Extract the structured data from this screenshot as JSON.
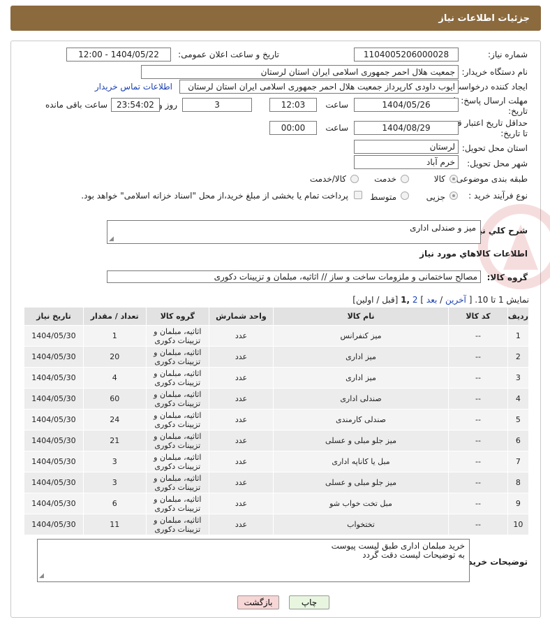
{
  "header": {
    "title": "جزئیات اطلاعات نیاز"
  },
  "form": {
    "need_number_label": "شماره نیاز:",
    "need_number": "1104005206000028",
    "announce_label": "تاریخ و ساعت اعلان عمومی:",
    "announce_value": "1404/05/22 - 12:00",
    "buyer_org_label": "نام دستگاه خریدار:",
    "buyer_org": "جمعیت هلال احمر جمهوری اسلامی ایران استان لرستان",
    "creator_label": "ایجاد کننده درخواست:",
    "creator": "ایوب داودی کارپرداز جمعیت هلال احمر جمهوری اسلامی ایران استان لرستان",
    "contact_link": "اطلاعات تماس خریدار",
    "deadline_label_1": "مهلت ارسال پاسخ: تا",
    "deadline_label_2": "تاریخ:",
    "deadline_date": "1404/05/26",
    "time_label": "ساعت",
    "deadline_time": "12:03",
    "days_value": "3",
    "days_label": "روز و",
    "remaining_time": "23:54:02",
    "remaining_label": "ساعت باقی مانده",
    "validity_label_1": "حداقل تاریخ اعتبار قیمت:",
    "validity_label_2": "تا تاریخ:",
    "validity_date": "1404/08/29",
    "validity_time": "00:00",
    "province_label": "استان محل تحویل:",
    "province": "لرستان",
    "city_label": "شهر محل تحویل:",
    "city": "خرم آباد",
    "category_label": "طبقه بندی موضوعی:",
    "category_options": [
      "کالا",
      "خدمت",
      "کالا/خدمت"
    ],
    "process_label": "نوع فرآیند خرید :",
    "process_options": [
      "جزیی",
      "متوسط"
    ],
    "payment_note": "پرداخت تمام یا بخشی از مبلغ خرید،از محل \"اسناد خزانه اسلامی\" خواهد بود.",
    "summary_label": "شرح کلي نياز:",
    "summary_value": "میز و صندلی اداری",
    "goods_info_title": "اطلاعات کالاهاي مورد نياز",
    "goods_group_label": "گروه کالا:",
    "goods_group_value": "مصالح ساختمانی و ملزومات ساخت و ساز // اثاثیه، مبلمان و تزیینات دکوری"
  },
  "pagination": {
    "showing": "نمایش 1 تا 10.",
    "open": "[",
    "last": "آخرین",
    "sep1": "/",
    "next": "بعد",
    "close": "]",
    "page2": "2",
    "page1": ",1",
    "prev_first": "[قبل / اولین]"
  },
  "table": {
    "headers": [
      "ردیف",
      "کد کالا",
      "نام کالا",
      "واحد شمارش",
      "گروه کالا",
      "تعداد / مقدار",
      "تاریخ نیاز"
    ],
    "rows": [
      [
        "1",
        "--",
        "میز کنفرانس",
        "عدد",
        "اثاثیه، مبلمان و تزیینات دکوری",
        "1",
        "1404/05/30"
      ],
      [
        "2",
        "--",
        "میز اداری",
        "عدد",
        "اثاثیه، مبلمان و تزیینات دکوری",
        "20",
        "1404/05/30"
      ],
      [
        "3",
        "--",
        "میز اداری",
        "عدد",
        "اثاثیه، مبلمان و تزیینات دکوری",
        "4",
        "1404/05/30"
      ],
      [
        "4",
        "--",
        "صندلی اداری",
        "عدد",
        "اثاثیه، مبلمان و تزیینات دکوری",
        "60",
        "1404/05/30"
      ],
      [
        "5",
        "--",
        "صندلی کارمندی",
        "عدد",
        "اثاثیه، مبلمان و تزیینات دکوری",
        "24",
        "1404/05/30"
      ],
      [
        "6",
        "--",
        "میز جلو مبلی و عسلی",
        "عدد",
        "اثاثیه، مبلمان و تزیینات دکوری",
        "21",
        "1404/05/30"
      ],
      [
        "7",
        "--",
        "مبل یا کاناپه اداری",
        "عدد",
        "اثاثیه، مبلمان و تزیینات دکوری",
        "3",
        "1404/05/30"
      ],
      [
        "8",
        "--",
        "میز جلو مبلی و عسلی",
        "عدد",
        "اثاثیه، مبلمان و تزیینات دکوری",
        "3",
        "1404/05/30"
      ],
      [
        "9",
        "--",
        "مبل تخت خواب شو",
        "عدد",
        "اثاثیه، مبلمان و تزیینات دکوری",
        "6",
        "1404/05/30"
      ],
      [
        "10",
        "--",
        "تختخواب",
        "عدد",
        "اثاثیه، مبلمان و تزیینات دکوری",
        "11",
        "1404/05/30"
      ]
    ]
  },
  "notes": {
    "label": "توضیحات خریدار:",
    "line1": "خرید مبلمان اداری طبق لیست پیوست",
    "line2": "به توضیحات لیست دقت گردد"
  },
  "buttons": {
    "print": "چاپ",
    "back": "بازگشت"
  },
  "colors": {
    "header_bg": "#8b6a3e",
    "link": "#1a3fb0",
    "back_btn_bg": "#f7d6d6",
    "print_btn_bg": "#e8f6e0"
  }
}
